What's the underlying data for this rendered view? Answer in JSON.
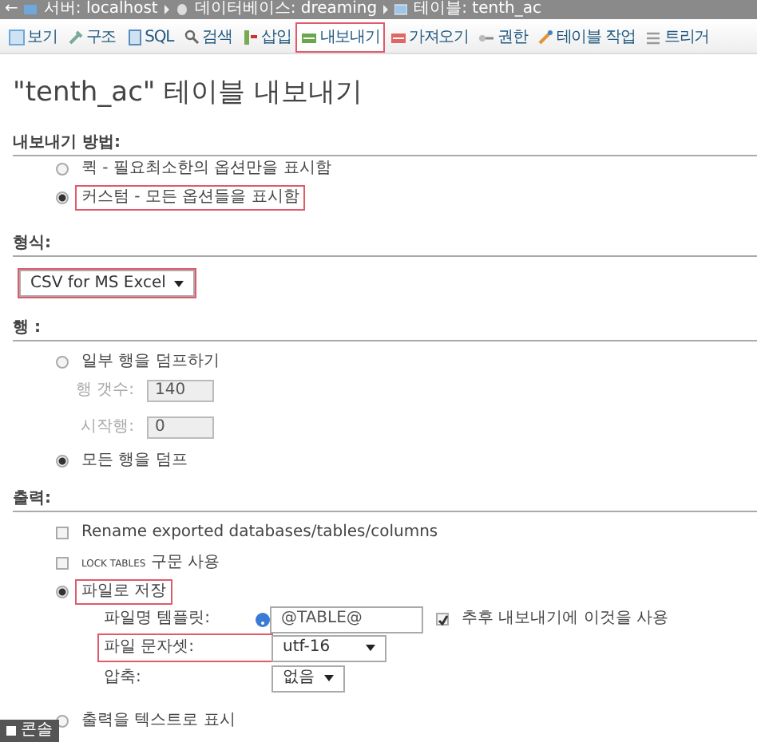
{
  "breadcrumb": {
    "back": "←",
    "items": [
      "서버: localhost",
      "데이터베이스: dreaming",
      "테이블: tenth_ac"
    ]
  },
  "tabs": [
    {
      "label": "보기",
      "selected": false,
      "highlighted": false
    },
    {
      "label": "구조",
      "selected": false,
      "highlighted": false
    },
    {
      "label": "SQL",
      "selected": false,
      "highlighted": false
    },
    {
      "label": "검색",
      "selected": false,
      "highlighted": false
    },
    {
      "label": "삽입",
      "selected": false,
      "highlighted": false
    },
    {
      "label": "내보내기",
      "selected": true,
      "highlighted": true
    },
    {
      "label": "가져오기",
      "selected": false,
      "highlighted": false
    },
    {
      "label": "권한",
      "selected": false,
      "highlighted": false
    },
    {
      "label": "테이블 작업",
      "selected": false,
      "highlighted": false
    },
    {
      "label": "트리거",
      "selected": false,
      "highlighted": false
    }
  ],
  "title": "\"tenth_ac\" 테이블 내보내기",
  "export_method": {
    "heading": "내보내기 방법:",
    "options": [
      {
        "label": "퀵 - 필요최소한의 옵션만을 표시함",
        "selected": false,
        "highlighted": false
      },
      {
        "label": "커스텀 - 모든 옵션들을 표시함",
        "selected": true,
        "highlighted": true
      }
    ]
  },
  "format": {
    "heading": "형식:",
    "value": "CSV for MS Excel",
    "highlighted": true
  },
  "rows": {
    "heading": "행 :",
    "options": [
      {
        "label": "일부 행을 덤프하기",
        "selected": false
      },
      {
        "label": "모든 행을 덤프",
        "selected": true
      }
    ],
    "row_count": {
      "label": "행 갯수:",
      "value": "140",
      "disabled": true
    },
    "start_row": {
      "label": "시작행:",
      "value": "0",
      "disabled": true
    }
  },
  "output": {
    "heading": "출력:",
    "checkboxes": [
      {
        "label": "Rename exported databases/tables/columns",
        "checked": false
      },
      {
        "code": "LOCK TABLES",
        "label": "구문 사용",
        "checked": false
      }
    ],
    "save_to_file": {
      "label": "파일로 저장",
      "selected": true,
      "highlighted": true
    },
    "fields": [
      {
        "kind": "input",
        "label": "파일명 템플릿:",
        "value": "@TABLE@",
        "help": true,
        "extra": {
          "label": "추후 내보내기에 이것을 사용",
          "checked": true
        },
        "highlighted": false
      },
      {
        "kind": "select",
        "label": "파일 문자셋:",
        "value": "utf-16",
        "highlighted": true
      },
      {
        "kind": "select_small",
        "label": "압축:",
        "value": "없음",
        "highlighted": false
      }
    ],
    "as_text": {
      "label": "출력을 텍스트로 표시",
      "selected": false
    }
  },
  "console": {
    "label": "콘솔"
  }
}
